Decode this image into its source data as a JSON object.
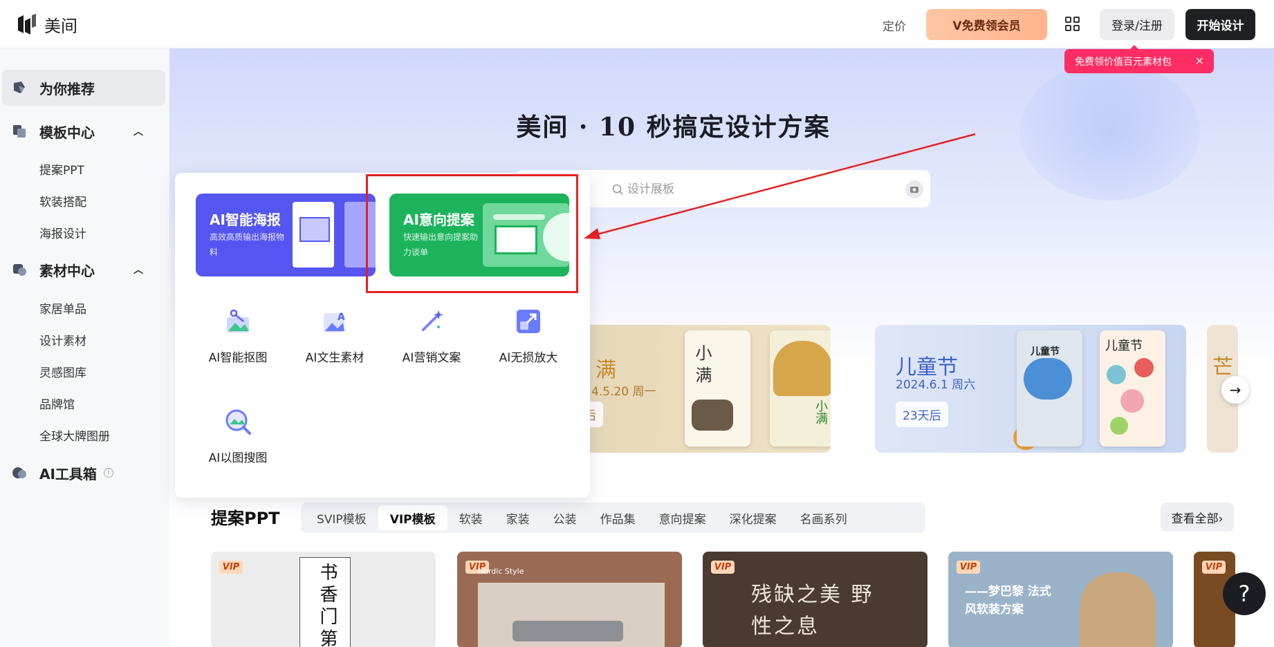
{
  "header": {
    "logo_text": "美间",
    "pricing": "定价",
    "vip_button": "V免费领会员",
    "login_button": "登录/注册",
    "start_button": "开始设计",
    "promo_tip": "免费领价值百元素材包",
    "promo_close": "×"
  },
  "sidebar": {
    "recommend": "为你推荐",
    "template_center": "模板中心",
    "template_items": [
      "提案PPT",
      "软装搭配",
      "海报设计"
    ],
    "material_center": "素材中心",
    "material_items": [
      "家居单品",
      "设计素材",
      "灵感图库",
      "品牌馆",
      "全球大牌图册"
    ],
    "ai_toolbox": "AI工具箱",
    "info_mark": "i",
    "chevron": "︿"
  },
  "hero": {
    "title": "美间 · 10 秒搞定设计方案",
    "search_placeholder": "设计展板"
  },
  "dropdown": {
    "card1": {
      "title": "AI智能海报",
      "desc": "高效高质输出海报物料"
    },
    "card2": {
      "title": "AI意向提案",
      "desc": "快速输出意向提案助力谈单"
    },
    "tools": [
      {
        "label": "AI智能抠图",
        "icon": "cutout-icon"
      },
      {
        "label": "AI文生素材",
        "icon": "text-to-image-icon"
      },
      {
        "label": "AI营销文案",
        "icon": "magic-wand-icon"
      },
      {
        "label": "AI无损放大",
        "icon": "upscale-icon"
      },
      {
        "label": "AI以图搜图",
        "icon": "image-search-icon"
      }
    ]
  },
  "banners": {
    "b1": {
      "title": "满",
      "date": "4.5.20 周一",
      "count": "后"
    },
    "b1_posters": [
      "小满",
      "小满"
    ],
    "b2": {
      "title": "儿童节",
      "date": "2024.6.1 周六",
      "count": "23天后"
    },
    "b2_posters": [
      "儿童节",
      "儿童节"
    ],
    "b3_title": "芒"
  },
  "section": {
    "title": "提案PPT",
    "tabs": [
      "SVIP模板",
      "VIP模板",
      "软装",
      "家装",
      "公装",
      "作品集",
      "意向提案",
      "深化提案",
      "名画系列"
    ],
    "active_tab": "VIP模板",
    "see_all": "查看全部›",
    "cards": [
      {
        "badge": "VIP",
        "text": "书香门第",
        "color": "#ececec"
      },
      {
        "badge": "VIP",
        "text": "Nordic Style",
        "color": "#9a6a55"
      },
      {
        "badge": "VIP",
        "text": "残缺之美 野性之息",
        "color": "#4a3a30"
      },
      {
        "badge": "VIP",
        "text": "——梦巴黎 法式风软装方案",
        "color": "#9bb3c9"
      },
      {
        "badge": "VIP",
        "text": "",
        "color": "#7a4a20"
      }
    ]
  },
  "misc": {
    "next_arrow": "→",
    "help": "?"
  },
  "colors": {
    "accent_dark": "#1f2023",
    "vip_gradient": "#ffb48e",
    "promo": "#ff2d63",
    "ai_purple": "#5555f2",
    "ai_green": "#1db35d",
    "annotation_red": "#e62020"
  }
}
